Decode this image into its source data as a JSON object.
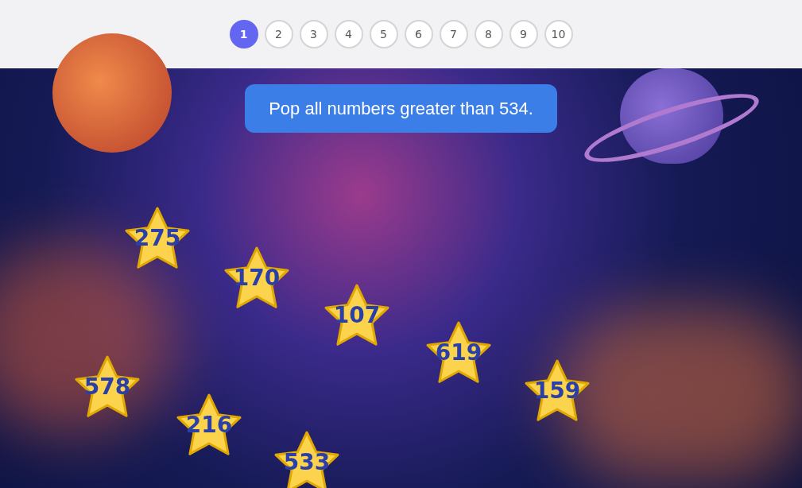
{
  "pages": [
    {
      "label": "1",
      "selected": true
    },
    {
      "label": "2",
      "selected": false
    },
    {
      "label": "3",
      "selected": false
    },
    {
      "label": "4",
      "selected": false
    },
    {
      "label": "5",
      "selected": false
    },
    {
      "label": "6",
      "selected": false
    },
    {
      "label": "7",
      "selected": false
    },
    {
      "label": "8",
      "selected": false
    },
    {
      "label": "9",
      "selected": false
    },
    {
      "label": "10",
      "selected": false
    }
  ],
  "prompt": "Pop all numbers greater than 534.",
  "stars": [
    {
      "number": "275"
    },
    {
      "number": "170"
    },
    {
      "number": "107"
    },
    {
      "number": "619"
    },
    {
      "number": "578"
    },
    {
      "number": "216"
    },
    {
      "number": "533"
    },
    {
      "number": "159"
    }
  ]
}
